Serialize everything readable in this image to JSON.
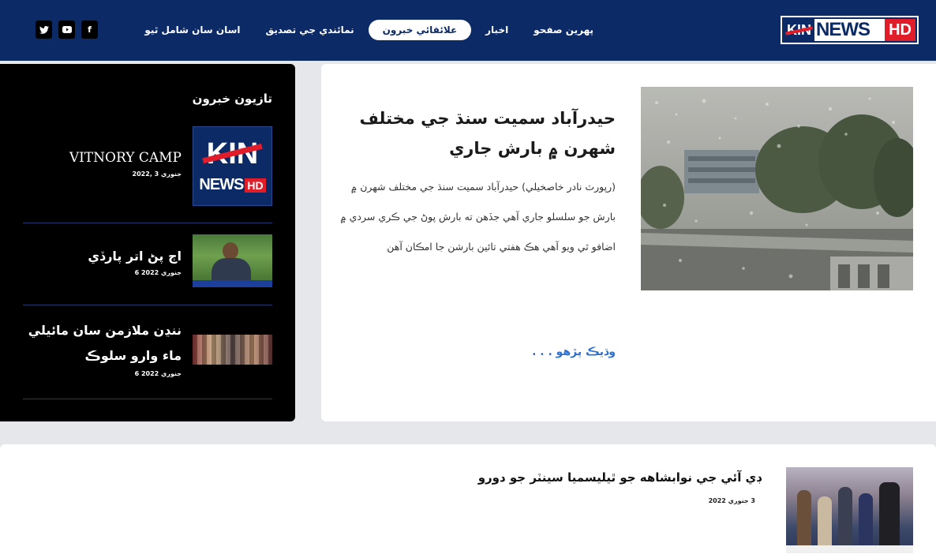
{
  "header": {
    "logo": {
      "kin": "KIN",
      "news": "NEWS",
      "hd": "HD"
    },
    "nav": [
      {
        "label": "پهرين صفحو",
        "active": false
      },
      {
        "label": "اخبار",
        "active": false
      },
      {
        "label": "علائقائي خبرون",
        "active": true
      },
      {
        "label": "نمائندي جي تصديق",
        "active": false
      },
      {
        "label": "اسان سان شامل ٿيو",
        "active": false
      }
    ],
    "social": [
      {
        "icon": "facebook-icon",
        "glyph": "f"
      },
      {
        "icon": "youtube-icon",
        "glyph": "▶"
      },
      {
        "icon": "twitter-icon",
        "glyph": "🐦"
      }
    ]
  },
  "sidebar": {
    "title": "تازيون خبرون",
    "items": [
      {
        "headline": "VITNORY CAMP",
        "date": "جنوري 3 ,2022",
        "thumb": "kin-news-logo"
      },
      {
        "headline": "اڄ پڻ اتر پارڏي",
        "date": "جنوري 2022 6",
        "thumb": "person-photo"
      },
      {
        "headline": "ننڍن ملازمن سان مائيلي ماء وارو سلوڪ",
        "date": "جنوري 2022 6",
        "thumb": "crowd-photo"
      }
    ],
    "thumb_logo": {
      "kin": "KIN",
      "news": "NEWS",
      "hd": "HD"
    }
  },
  "article": {
    "title": "حيدرآباد سميت سنڌ جي مختلف شهرن ۾ بارش جاري",
    "body": "(رپورٽ نادر خاصخيلي) حيدرآباد سميت سنڌ جي مختلف شهرن ۾ بارش جو سلسلو جاري آهي جڏهن ته بارش پوڻ جي ڪري سردي ۾ اضافو ٿي ويو آهي هڪ هفتي تائين بارشن جا امڪان آهن",
    "read_more": "وڌيڪ پڙهو . . ."
  },
  "bottom": {
    "title": "ڊي آئي جي نوابشاهه جو ٿيليسميا سينٽر جو دورو",
    "date": "3 جنوري 2022"
  },
  "colors": {
    "header_bg": "#0b2a66",
    "accent_red": "#e11d2a",
    "link_blue": "#2f6fd0",
    "sidebar_bg": "#000000"
  }
}
